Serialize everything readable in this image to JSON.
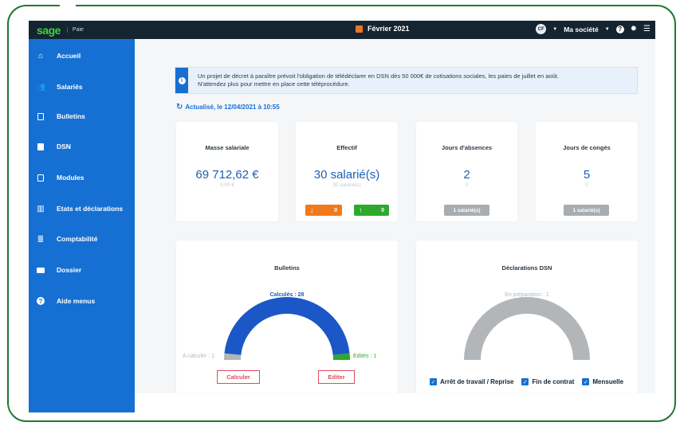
{
  "topbar": {
    "logo": "sage",
    "app_label": "Paie",
    "month": "Février 2021",
    "avatar_initials": "CF",
    "company": "Ma société"
  },
  "sidebar": {
    "items": [
      {
        "label": "Accueil",
        "icon": "home-icon"
      },
      {
        "label": "Salariés",
        "icon": "users-icon"
      },
      {
        "label": "Bulletins",
        "icon": "document-icon"
      },
      {
        "label": "DSN",
        "icon": "file-icon"
      },
      {
        "label": "Modules",
        "icon": "module-icon"
      },
      {
        "label": "Etats et déclarations",
        "icon": "books-icon"
      },
      {
        "label": "Comptabilité",
        "icon": "ledger-icon"
      },
      {
        "label": "Dossier",
        "icon": "folder-icon"
      },
      {
        "label": "Aide menus",
        "icon": "help-icon"
      }
    ]
  },
  "info": {
    "line1": "Un projet de décret à paraître prévoit l'obligation de télédéclarer en DSN dès 50 000€ de cotisations sociales, les paies de juillet en août.",
    "line2": "N'attendez plus pour mettre en place cette téléprocédure."
  },
  "refresh_text": "Actualisé, le 12/04/2021 à 10:55",
  "cards": {
    "masse": {
      "title": "Masse salariale",
      "value": "69 712,62 €",
      "sub": "0,00 €"
    },
    "effectif": {
      "title": "Effectif",
      "value": "30 salarié(s)",
      "sub": "30 salarié(s)",
      "down": "0",
      "up": "0"
    },
    "absences": {
      "title": "Jours d'absences",
      "value": "2",
      "sub": "0",
      "badge": "1 salarié(s)"
    },
    "conges": {
      "title": "Jours de congés",
      "value": "5",
      "sub": "0",
      "badge": "1 salarié(s)"
    }
  },
  "bulletins": {
    "title": "Bulletins",
    "calcules": "Calculés : 28",
    "a_calculer": "A calculer : 1",
    "edites": "Edités : 1",
    "calculer_btn": "Calculer",
    "editer_btn": "Editer",
    "gauge": {
      "calcules": 28,
      "a_calculer": 1,
      "edites": 1
    }
  },
  "dsn": {
    "title": "Déclarations DSN",
    "preparation": "En préparation : 1",
    "checks": [
      "Arrêt de travail / Reprise",
      "Fin de contrat",
      "Mensuelle"
    ]
  },
  "colors": {
    "accent": "#1670d3",
    "topbar": "#142431",
    "gauge_blue": "#1b57c6",
    "gauge_green": "#2ea82e",
    "gauge_gray": "#b2b6b9",
    "danger": "#e04a61"
  }
}
